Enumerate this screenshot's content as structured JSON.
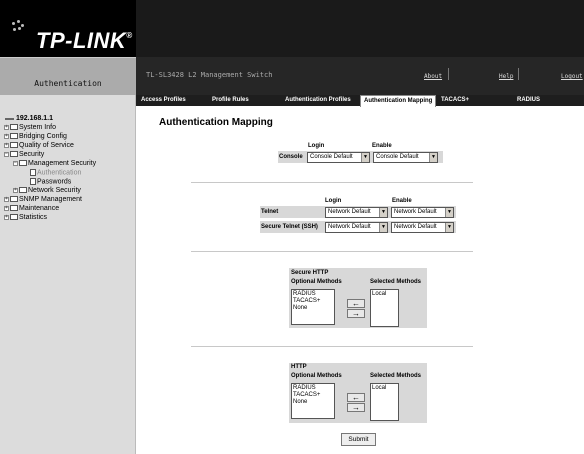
{
  "header": {
    "brand": "TP-LINK",
    "section_title": "Authentication",
    "switch_name": "TL-SL3428 L2 Management Switch",
    "links": [
      "About",
      "Help",
      "Logout"
    ]
  },
  "tabs": [
    "Access Profiles",
    "Profile Rules",
    "Authentication Profiles",
    "Authentication Mapping",
    "TACACS+",
    "RADIUS"
  ],
  "active_tab": "Authentication Mapping",
  "sidebar": {
    "root": "192.168.1.1",
    "items": [
      "System Info",
      "Bridging Config",
      "Quality of Service",
      "Security",
      "Management Security",
      "Authentication",
      "Passwords",
      "Network Security",
      "SNMP Management",
      "Maintenance",
      "Statistics"
    ]
  },
  "main": {
    "title": "Authentication Mapping",
    "console": {
      "label": "Console",
      "col_login": "Login",
      "col_enable": "Enable",
      "login_value": "Console Default",
      "enable_value": "Console Default"
    },
    "remote": {
      "col_login": "Login",
      "col_enable": "Enable",
      "rows": [
        {
          "label": "Telnet",
          "login": "Network Default",
          "enable": "Network Default"
        },
        {
          "label": "Secure Telnet (SSH)",
          "login": "Network Default",
          "enable": "Network Default"
        }
      ]
    },
    "https": {
      "title": "Secure HTTP",
      "optional_label": "Optional Methods",
      "selected_label": "Selected Methods",
      "optional": [
        "RADIUS",
        "TACACS+",
        "None"
      ],
      "selected": [
        "Local"
      ]
    },
    "http": {
      "title": "HTTP",
      "optional_label": "Optional Methods",
      "selected_label": "Selected Methods",
      "optional": [
        "RADIUS",
        "TACACS+",
        "None"
      ],
      "selected": [
        "Local"
      ]
    },
    "submit_label": "Submit"
  },
  "icons": {
    "arrow_left": "←",
    "arrow_right": "→",
    "dropdown": "▼"
  }
}
